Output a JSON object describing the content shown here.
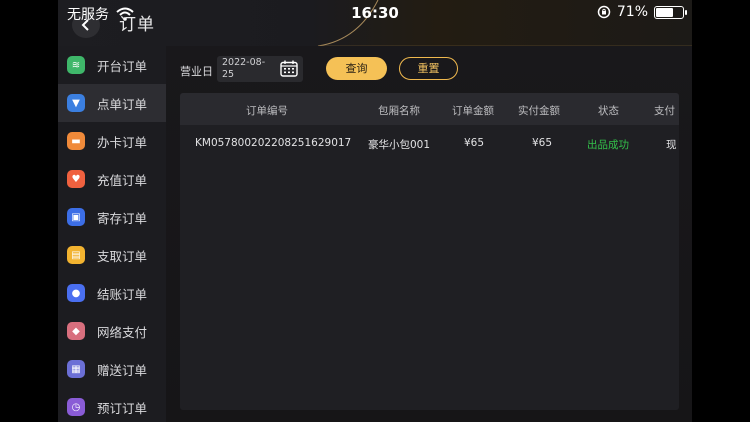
{
  "status_bar": {
    "carrier": "无服务",
    "time": "16:30",
    "battery": "71%",
    "battery_level": 0.71
  },
  "header": {
    "title": "订单"
  },
  "sidebar": {
    "items": [
      {
        "label": "开台订单",
        "color": "#3fb76a"
      },
      {
        "label": "点单订单",
        "color": "#3b7fe0",
        "active": true
      },
      {
        "label": "办卡订单",
        "color": "#f08a3a"
      },
      {
        "label": "充值订单",
        "color": "#f0613f"
      },
      {
        "label": "寄存订单",
        "color": "#3c6ee6"
      },
      {
        "label": "支取订单",
        "color": "#f2b330"
      },
      {
        "label": "结账订单",
        "color": "#4a6ff0"
      },
      {
        "label": "网络支付",
        "color": "#d86f7e"
      },
      {
        "label": "赠送订单",
        "color": "#6b6fd6"
      },
      {
        "label": "预订订单",
        "color": "#8a5cd6"
      }
    ]
  },
  "filter": {
    "label": "营业日",
    "date_value": "2022-08-25",
    "query_button": "查询",
    "reset_button": "重置"
  },
  "table": {
    "columns": [
      "订单编号",
      "包厢名称",
      "订单金额",
      "实付金额",
      "状态",
      "支付"
    ],
    "rows": [
      {
        "order_no": "KM0578002022082516290​17",
        "room": "豪华小包001",
        "amount": "¥65",
        "paid": "¥65",
        "status": "出品成功",
        "pay": "现"
      }
    ]
  },
  "colors": {
    "accent": "#f5c156",
    "success": "#33c04a"
  }
}
